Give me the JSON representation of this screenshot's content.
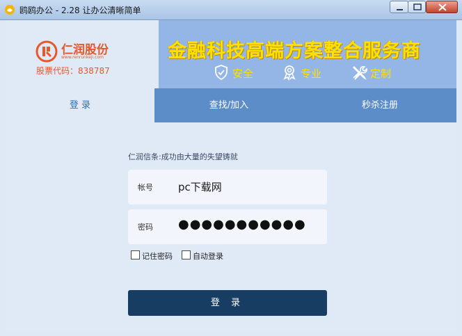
{
  "window": {
    "title": "鸥鸥办公 - 2.28 让办公清晰简单",
    "icon": "app-logo-icon"
  },
  "banner": {
    "brand_name": "仁润股份",
    "brand_url": "www.renrunkeji.com",
    "stock_code": "股票代码：838787",
    "slogan": "金融科技高端方案整合服务商",
    "features": [
      {
        "label": "安全",
        "icon": "shield-check-icon"
      },
      {
        "label": "专业",
        "icon": "medal-icon"
      },
      {
        "label": "定制",
        "icon": "wrench-pencil-icon"
      }
    ]
  },
  "tabs": [
    {
      "label": "登 录",
      "active": true
    },
    {
      "label": "查找/加入",
      "active": false
    },
    {
      "label": "秒杀注册",
      "active": false
    }
  ],
  "form": {
    "tagline": "仁润信条:成功由大量的失望铸就",
    "account_label": "帐号",
    "account_value": "pc下载网",
    "password_label": "密码",
    "password_mask": "●●●●●●●●●●●",
    "remember_label": "记住密码",
    "auto_login_label": "自动登录",
    "submit_label": "登 录"
  },
  "colors": {
    "brand_orange": "#e8562a",
    "slogan_yellow": "#ffe100",
    "tab_blue": "#5c8dc8",
    "button_navy": "#173e62"
  }
}
